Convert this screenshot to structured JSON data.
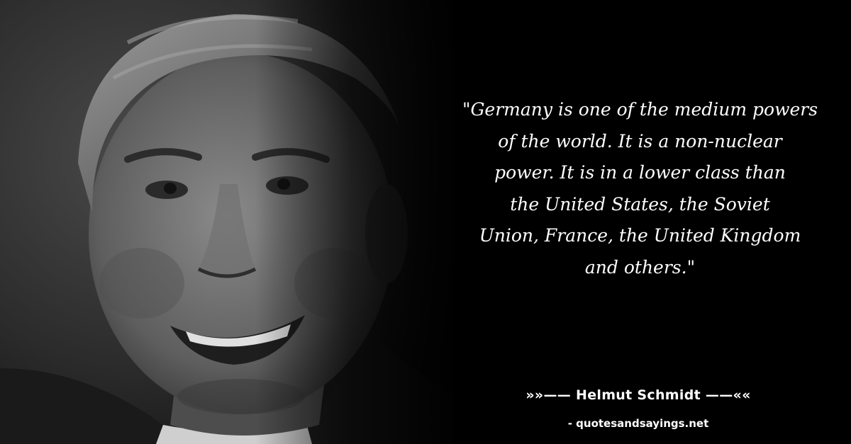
{
  "quote": {
    "lines": [
      "\"Germany is one of the medium powers",
      "of the world. It is a non-nuclear",
      "power. It is in a lower class than",
      "the United States, the Soviet",
      "Union, France, the United Kingdom",
      "and others.\""
    ]
  },
  "author": {
    "label": "»»—— Helmut Schmidt ——««"
  },
  "source": {
    "label": "- quotesandsayings.net"
  },
  "colors": {
    "background": "#000000",
    "text": "#ffffff"
  }
}
